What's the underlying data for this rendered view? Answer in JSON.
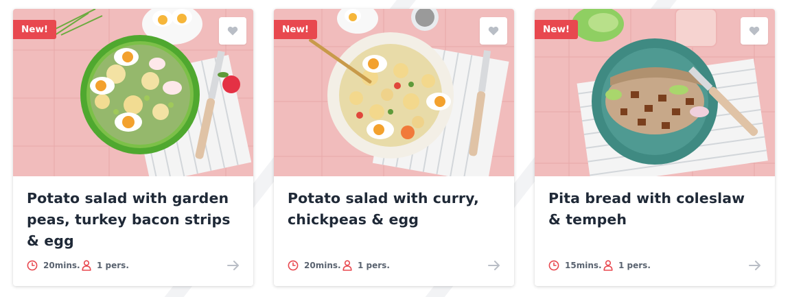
{
  "colors": {
    "accent": "#e8484f",
    "title": "#1f2937",
    "meta_text": "#5a6370",
    "meta_icon": "#e8484f",
    "arrow": "#b9bec6",
    "heart": "#b9bec6",
    "image_background": "#f1bcbc"
  },
  "cards": [
    {
      "badge": "New!",
      "title": "Potato salad with garden peas, turkey bacon strips & egg",
      "time": "20mins.",
      "persons": "1 pers.",
      "icons": {
        "time": "clock-icon",
        "persons": "person-icon",
        "favorite": "heart-icon",
        "open": "arrow-right-icon"
      }
    },
    {
      "badge": "New!",
      "title": "Potato salad with curry, chickpeas & egg",
      "time": "20mins.",
      "persons": "1 pers.",
      "icons": {
        "time": "clock-icon",
        "persons": "person-icon",
        "favorite": "heart-icon",
        "open": "arrow-right-icon"
      }
    },
    {
      "badge": "New!",
      "title": "Pita bread with coleslaw & tempeh",
      "time": "15mins.",
      "persons": "1 pers.",
      "icons": {
        "time": "clock-icon",
        "persons": "person-icon",
        "favorite": "heart-icon",
        "open": "arrow-right-icon"
      }
    }
  ]
}
